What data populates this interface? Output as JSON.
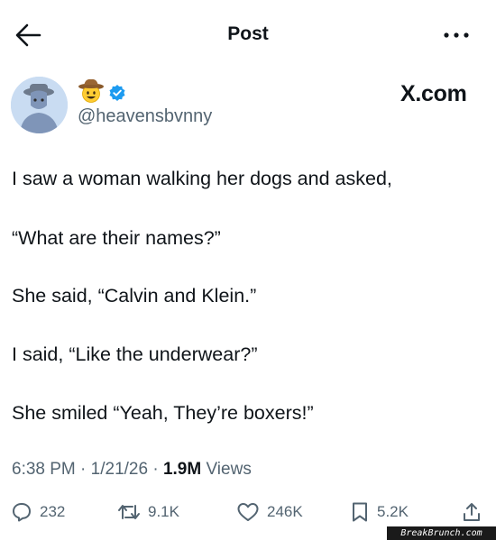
{
  "header": {
    "title": "Post"
  },
  "user": {
    "name_emoji": "cowboy-face",
    "handle": "@heavensbvnny",
    "verified": true
  },
  "brand": "X.com",
  "tweet": {
    "lines": [
      "I saw a woman walking her dogs and asked,",
      "“What are their names?”",
      "She said, “Calvin and Klein.”",
      "I said, “Like the underwear?”",
      "She smiled “Yeah, They’re boxers!”"
    ]
  },
  "meta": {
    "time": "6:38 PM",
    "sep1": " · ",
    "date": "1/21/26",
    "sep2": " · ",
    "views_count": "1.9M",
    "views_label": " Views"
  },
  "actions": {
    "replies": "232",
    "reposts": "9.1K",
    "likes": "246K",
    "bookmarks": "5.2K"
  },
  "watermark": "BreakBrunch.com",
  "colors": {
    "text": "#0f1419",
    "secondary": "#536471",
    "verified": "#1d9bf0"
  }
}
